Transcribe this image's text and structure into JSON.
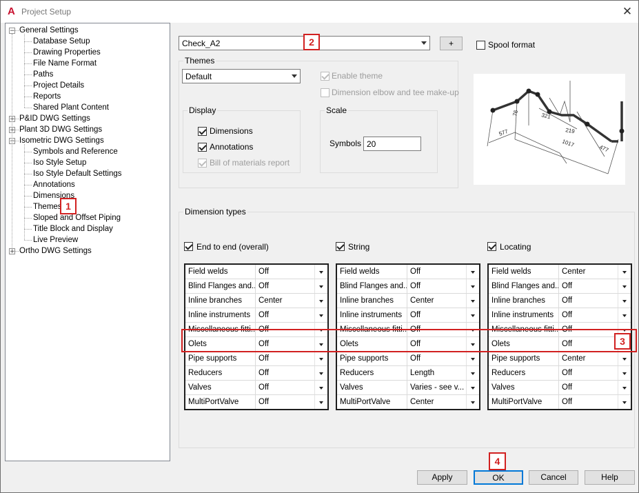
{
  "window": {
    "title": "Project Setup",
    "logo": "A",
    "close_glyph": "✕"
  },
  "tree": {
    "items": [
      {
        "label": "General Settings",
        "level": 0,
        "expander": "−"
      },
      {
        "label": "Database Setup",
        "level": 1
      },
      {
        "label": "Drawing Properties",
        "level": 1
      },
      {
        "label": "File Name Format",
        "level": 1
      },
      {
        "label": "Paths",
        "level": 1
      },
      {
        "label": "Project Details",
        "level": 1
      },
      {
        "label": "Reports",
        "level": 1
      },
      {
        "label": "Shared Plant Content",
        "level": 1
      },
      {
        "label": "P&ID DWG Settings",
        "level": 0,
        "expander": "+"
      },
      {
        "label": "Plant 3D DWG Settings",
        "level": 0,
        "expander": "+"
      },
      {
        "label": "Isometric DWG Settings",
        "level": 0,
        "expander": "−"
      },
      {
        "label": "Symbols and Reference",
        "level": 1
      },
      {
        "label": "Iso Style Setup",
        "level": 1
      },
      {
        "label": "Iso Style Default Settings",
        "level": 1
      },
      {
        "label": "Annotations",
        "level": 1
      },
      {
        "label": "Dimensions",
        "level": 1
      },
      {
        "label": "Themes",
        "level": 1
      },
      {
        "label": "Sloped and Offset Piping",
        "level": 1
      },
      {
        "label": "Title Block and Display",
        "level": 1
      },
      {
        "label": "Live Preview",
        "level": 1
      },
      {
        "label": "Ortho DWG Settings",
        "level": 0,
        "expander": "+"
      }
    ]
  },
  "style_combo": {
    "value": "Check_A2"
  },
  "add_button": {
    "label": "+"
  },
  "spool_format": {
    "label": "Spool format",
    "checked": false
  },
  "themes": {
    "group_label": "Themes",
    "combo_value": "Default",
    "enable_theme": {
      "label": "Enable theme",
      "checked": true,
      "disabled": true
    },
    "dimension_elbow": {
      "label": "Dimension elbow and tee make-up",
      "checked": false,
      "disabled": true
    }
  },
  "display": {
    "group_label": "Display",
    "dimensions": {
      "label": "Dimensions",
      "checked": true
    },
    "annotations": {
      "label": "Annotations",
      "checked": true
    },
    "bom": {
      "label": "Bill of materials report",
      "checked": true,
      "disabled": true
    }
  },
  "scale": {
    "group_label": "Scale",
    "symbols_label": "Symbols",
    "symbols_value": "20"
  },
  "preview": {
    "dims": [
      "76",
      "321",
      "577",
      "219",
      "1017",
      "477"
    ]
  },
  "dimension_types": {
    "group_label": "Dimension types",
    "columns": [
      {
        "label": "End to end (overall)",
        "checked": true,
        "rows": [
          {
            "name": "Field welds",
            "value": "Off"
          },
          {
            "name": "Blind Flanges and...",
            "value": "Off"
          },
          {
            "name": "Inline branches",
            "value": "Center"
          },
          {
            "name": "Inline instruments",
            "value": "Off"
          },
          {
            "name": "Miscellaneous fitti...",
            "value": "Off"
          },
          {
            "name": "Olets",
            "value": "Off"
          },
          {
            "name": "Pipe supports",
            "value": "Off"
          },
          {
            "name": "Reducers",
            "value": "Off"
          },
          {
            "name": "Valves",
            "value": "Off"
          },
          {
            "name": "MultiPortValve",
            "value": "Off"
          }
        ]
      },
      {
        "label": "String",
        "checked": true,
        "rows": [
          {
            "name": "Field welds",
            "value": "Off"
          },
          {
            "name": "Blind Flanges and...",
            "value": "Off"
          },
          {
            "name": "Inline branches",
            "value": "Center"
          },
          {
            "name": "Inline instruments",
            "value": "Off"
          },
          {
            "name": "Miscellaneous fitti...",
            "value": "Off"
          },
          {
            "name": "Olets",
            "value": "Off"
          },
          {
            "name": "Pipe supports",
            "value": "Off"
          },
          {
            "name": "Reducers",
            "value": "Length"
          },
          {
            "name": "Valves",
            "value": "Varies - see v..."
          },
          {
            "name": "MultiPortValve",
            "value": "Center"
          }
        ]
      },
      {
        "label": "Locating",
        "checked": true,
        "rows": [
          {
            "name": "Field welds",
            "value": "Center"
          },
          {
            "name": "Blind Flanges and...",
            "value": "Off"
          },
          {
            "name": "Inline branches",
            "value": "Off"
          },
          {
            "name": "Inline instruments",
            "value": "Off"
          },
          {
            "name": "Miscellaneous fitti...",
            "value": "Off"
          },
          {
            "name": "Olets",
            "value": "Off"
          },
          {
            "name": "Pipe supports",
            "value": "Center"
          },
          {
            "name": "Reducers",
            "value": "Off"
          },
          {
            "name": "Valves",
            "value": "Off"
          },
          {
            "name": "MultiPortValve",
            "value": "Off"
          }
        ]
      }
    ]
  },
  "buttons": {
    "apply": "Apply",
    "ok": "OK",
    "cancel": "Cancel",
    "help": "Help"
  },
  "callouts": {
    "one": "1",
    "two": "2",
    "three": "3",
    "four": "4"
  },
  "colors": {
    "callout": "#d12020",
    "accent": "#0078d7"
  }
}
